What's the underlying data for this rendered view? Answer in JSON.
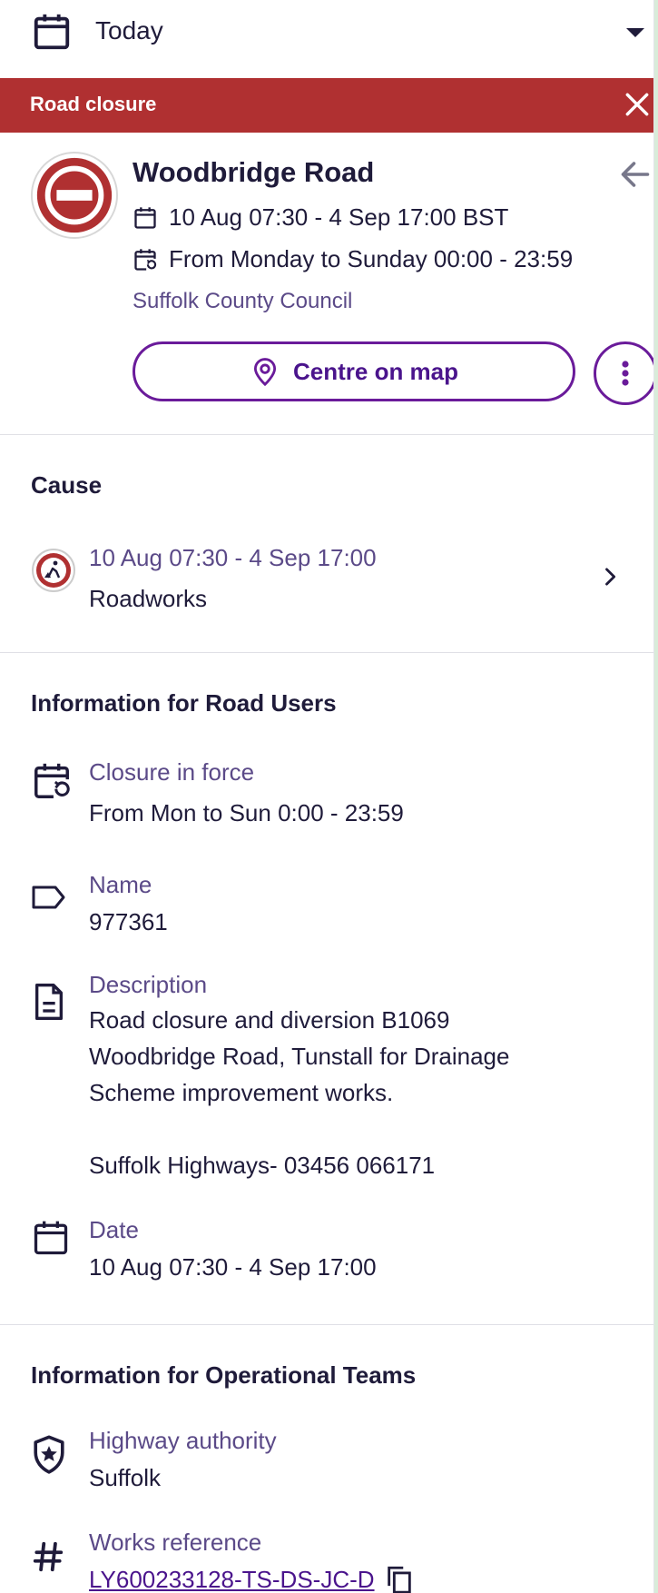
{
  "date_selector": {
    "value": "Today",
    "icon": "calendar-icon"
  },
  "banner": {
    "title": "Road closure",
    "close_icon": "close-icon"
  },
  "event": {
    "road": "Woodbridge Road",
    "date_range": "10 Aug 07:30 - 4 Sep 17:00 BST",
    "recurrence": "From Monday to Sunday 00:00 - 23:59",
    "authority": "Suffolk County Council",
    "centre_button": "Centre on map",
    "colors": {
      "closure_red": "#b03031",
      "accent_purple": "#6a1b9a",
      "label_purple": "#5b4a88"
    }
  },
  "cause": {
    "heading": "Cause",
    "item": {
      "date_range": "10 Aug 07:30 - 4 Sep 17:00",
      "type": "Roadworks",
      "icon": "roadworks-icon"
    }
  },
  "road_users": {
    "heading": "Information for Road Users",
    "items": [
      {
        "label": "Closure in force",
        "value": "From Mon to Sun 0:00 - 23:59",
        "icon": "calendar-repeat-icon"
      },
      {
        "label": "Name",
        "value": "977361",
        "icon": "tag-icon"
      },
      {
        "label": "Description",
        "value": "Road closure and diversion B1069\nWoodbridge Road, Tunstall for Drainage\nScheme improvement works.\n\nSuffolk Highways- 03456 066171",
        "icon": "document-icon"
      },
      {
        "label": "Date",
        "value": "10 Aug 07:30 - 4 Sep 17:00",
        "icon": "calendar-icon"
      }
    ]
  },
  "operational": {
    "heading": "Information for Operational Teams",
    "items": [
      {
        "label": "Highway authority",
        "value": "Suffolk",
        "icon": "shield-star-icon"
      },
      {
        "label": "Works reference",
        "value": "LY600233128-TS-DS-JC-D",
        "icon": "hash-icon"
      }
    ]
  }
}
